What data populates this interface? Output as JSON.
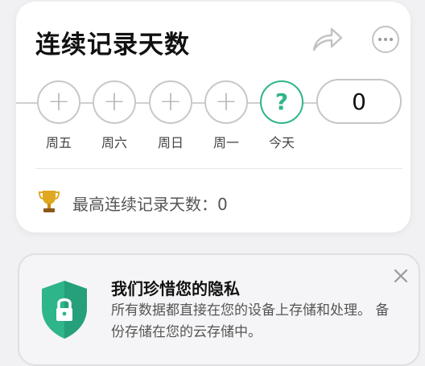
{
  "streak": {
    "title": "连续记录天数",
    "days": [
      {
        "label": "周五",
        "state": "empty"
      },
      {
        "label": "周六",
        "state": "empty"
      },
      {
        "label": "周日",
        "state": "empty"
      },
      {
        "label": "周一",
        "state": "empty"
      },
      {
        "label": "今天",
        "state": "today",
        "symbol": "?"
      }
    ],
    "count": "0",
    "best_text": "最高连续记录天数：0",
    "icons": {
      "share": "share-arrow-icon",
      "more": "more-dots-icon",
      "trophy": "trophy-icon"
    }
  },
  "privacy": {
    "title": "我们珍惜您的隐私",
    "body": "所有数据都直接在您的设备上存储和处理。 备份存储在您的云存储中。",
    "icons": {
      "shield": "shield-lock-icon",
      "close": "close-icon"
    }
  },
  "colors": {
    "accent": "#2fb58a",
    "background": "#f1f1f3",
    "card": "#ffffff",
    "trophy": "#e0a820"
  }
}
